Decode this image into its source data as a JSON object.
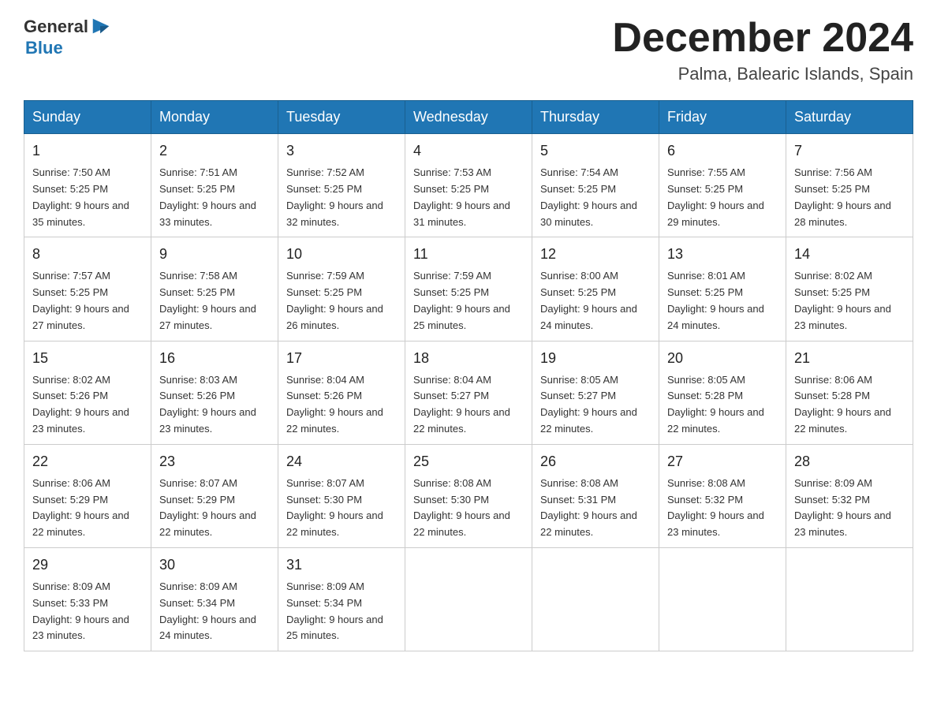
{
  "header": {
    "logo_general": "General",
    "logo_blue": "Blue",
    "title": "December 2024",
    "location": "Palma, Balearic Islands, Spain"
  },
  "weekdays": [
    "Sunday",
    "Monday",
    "Tuesday",
    "Wednesday",
    "Thursday",
    "Friday",
    "Saturday"
  ],
  "weeks": [
    [
      {
        "day": "1",
        "sunrise": "7:50 AM",
        "sunset": "5:25 PM",
        "daylight": "9 hours and 35 minutes."
      },
      {
        "day": "2",
        "sunrise": "7:51 AM",
        "sunset": "5:25 PM",
        "daylight": "9 hours and 33 minutes."
      },
      {
        "day": "3",
        "sunrise": "7:52 AM",
        "sunset": "5:25 PM",
        "daylight": "9 hours and 32 minutes."
      },
      {
        "day": "4",
        "sunrise": "7:53 AM",
        "sunset": "5:25 PM",
        "daylight": "9 hours and 31 minutes."
      },
      {
        "day": "5",
        "sunrise": "7:54 AM",
        "sunset": "5:25 PM",
        "daylight": "9 hours and 30 minutes."
      },
      {
        "day": "6",
        "sunrise": "7:55 AM",
        "sunset": "5:25 PM",
        "daylight": "9 hours and 29 minutes."
      },
      {
        "day": "7",
        "sunrise": "7:56 AM",
        "sunset": "5:25 PM",
        "daylight": "9 hours and 28 minutes."
      }
    ],
    [
      {
        "day": "8",
        "sunrise": "7:57 AM",
        "sunset": "5:25 PM",
        "daylight": "9 hours and 27 minutes."
      },
      {
        "day": "9",
        "sunrise": "7:58 AM",
        "sunset": "5:25 PM",
        "daylight": "9 hours and 27 minutes."
      },
      {
        "day": "10",
        "sunrise": "7:59 AM",
        "sunset": "5:25 PM",
        "daylight": "9 hours and 26 minutes."
      },
      {
        "day": "11",
        "sunrise": "7:59 AM",
        "sunset": "5:25 PM",
        "daylight": "9 hours and 25 minutes."
      },
      {
        "day": "12",
        "sunrise": "8:00 AM",
        "sunset": "5:25 PM",
        "daylight": "9 hours and 24 minutes."
      },
      {
        "day": "13",
        "sunrise": "8:01 AM",
        "sunset": "5:25 PM",
        "daylight": "9 hours and 24 minutes."
      },
      {
        "day": "14",
        "sunrise": "8:02 AM",
        "sunset": "5:25 PM",
        "daylight": "9 hours and 23 minutes."
      }
    ],
    [
      {
        "day": "15",
        "sunrise": "8:02 AM",
        "sunset": "5:26 PM",
        "daylight": "9 hours and 23 minutes."
      },
      {
        "day": "16",
        "sunrise": "8:03 AM",
        "sunset": "5:26 PM",
        "daylight": "9 hours and 23 minutes."
      },
      {
        "day": "17",
        "sunrise": "8:04 AM",
        "sunset": "5:26 PM",
        "daylight": "9 hours and 22 minutes."
      },
      {
        "day": "18",
        "sunrise": "8:04 AM",
        "sunset": "5:27 PM",
        "daylight": "9 hours and 22 minutes."
      },
      {
        "day": "19",
        "sunrise": "8:05 AM",
        "sunset": "5:27 PM",
        "daylight": "9 hours and 22 minutes."
      },
      {
        "day": "20",
        "sunrise": "8:05 AM",
        "sunset": "5:28 PM",
        "daylight": "9 hours and 22 minutes."
      },
      {
        "day": "21",
        "sunrise": "8:06 AM",
        "sunset": "5:28 PM",
        "daylight": "9 hours and 22 minutes."
      }
    ],
    [
      {
        "day": "22",
        "sunrise": "8:06 AM",
        "sunset": "5:29 PM",
        "daylight": "9 hours and 22 minutes."
      },
      {
        "day": "23",
        "sunrise": "8:07 AM",
        "sunset": "5:29 PM",
        "daylight": "9 hours and 22 minutes."
      },
      {
        "day": "24",
        "sunrise": "8:07 AM",
        "sunset": "5:30 PM",
        "daylight": "9 hours and 22 minutes."
      },
      {
        "day": "25",
        "sunrise": "8:08 AM",
        "sunset": "5:30 PM",
        "daylight": "9 hours and 22 minutes."
      },
      {
        "day": "26",
        "sunrise": "8:08 AM",
        "sunset": "5:31 PM",
        "daylight": "9 hours and 22 minutes."
      },
      {
        "day": "27",
        "sunrise": "8:08 AM",
        "sunset": "5:32 PM",
        "daylight": "9 hours and 23 minutes."
      },
      {
        "day": "28",
        "sunrise": "8:09 AM",
        "sunset": "5:32 PM",
        "daylight": "9 hours and 23 minutes."
      }
    ],
    [
      {
        "day": "29",
        "sunrise": "8:09 AM",
        "sunset": "5:33 PM",
        "daylight": "9 hours and 23 minutes."
      },
      {
        "day": "30",
        "sunrise": "8:09 AM",
        "sunset": "5:34 PM",
        "daylight": "9 hours and 24 minutes."
      },
      {
        "day": "31",
        "sunrise": "8:09 AM",
        "sunset": "5:34 PM",
        "daylight": "9 hours and 25 minutes."
      },
      null,
      null,
      null,
      null
    ]
  ],
  "labels": {
    "sunrise_prefix": "Sunrise: ",
    "sunset_prefix": "Sunset: ",
    "daylight_prefix": "Daylight: "
  }
}
